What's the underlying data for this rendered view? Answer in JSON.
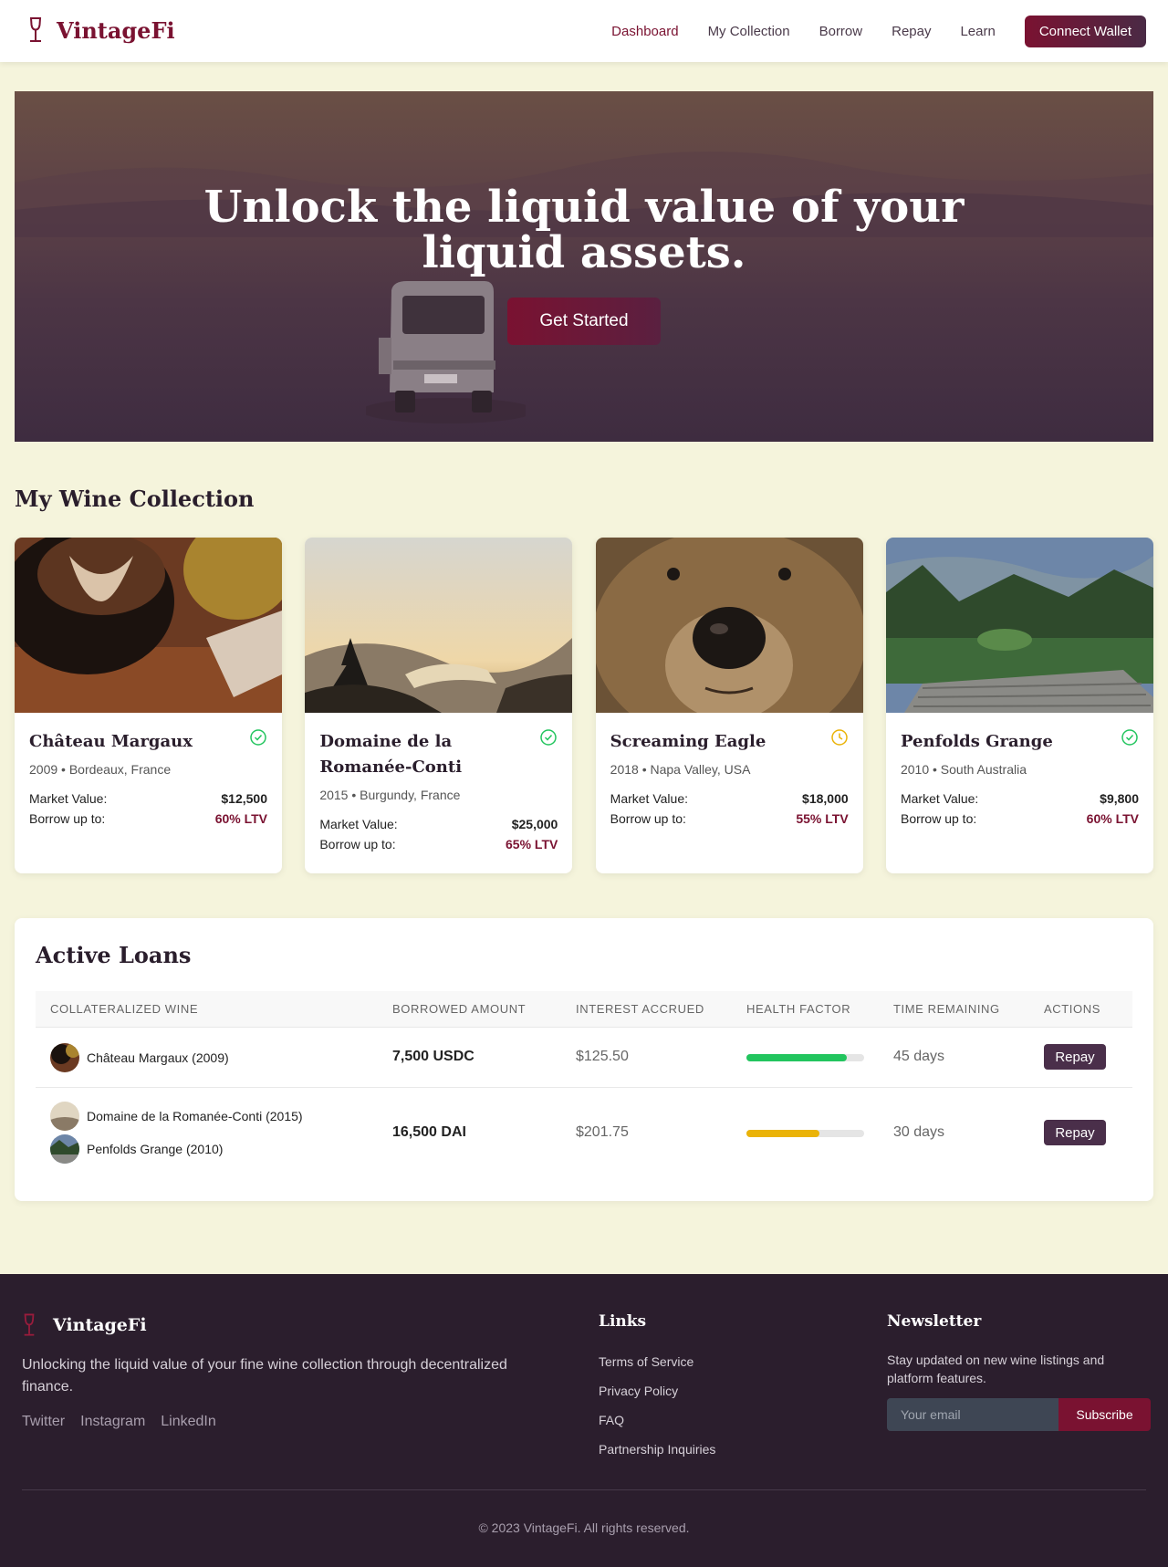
{
  "nav": {
    "brand": "VintageFi",
    "links": [
      "Dashboard",
      "My Collection",
      "Borrow",
      "Repay",
      "Learn"
    ],
    "active": "Dashboard",
    "cta": "Connect Wallet"
  },
  "hero": {
    "title_line1": "Unlock the liquid value of your",
    "title_line2": "liquid assets.",
    "cta": "Get Started"
  },
  "collection": {
    "title": "My Wine Collection",
    "market_label": "Market Value:",
    "borrow_label": "Borrow up to:",
    "cards": [
      {
        "name": "Château Margaux",
        "meta": "2009 • Bordeaux, France",
        "value": "$12,500",
        "ltv": "60% LTV",
        "status": "verified",
        "image": "coffee-cup"
      },
      {
        "name": "Domaine de la Romanée-Conti",
        "meta": "2015 • Burgundy, France",
        "value": "$25,000",
        "ltv": "65% LTV",
        "status": "verified",
        "image": "sunset-valley"
      },
      {
        "name": "Screaming Eagle",
        "meta": "2018 • Napa Valley, USA",
        "value": "$18,000",
        "ltv": "55% LTV",
        "status": "pending",
        "image": "bear-face"
      },
      {
        "name": "Penfolds Grange",
        "meta": "2010 • South Australia",
        "value": "$9,800",
        "ltv": "60% LTV",
        "status": "verified",
        "image": "lake-dock"
      }
    ]
  },
  "loans": {
    "title": "Active Loans",
    "headers": [
      "COLLATERALIZED WINE",
      "BORROWED AMOUNT",
      "INTEREST ACCRUED",
      "HEALTH FACTOR",
      "TIME REMAINING",
      "ACTIONS"
    ],
    "rows": [
      {
        "wines": [
          "Château Margaux (2009)"
        ],
        "amount": "7,500 USDC",
        "interest": "$125.50",
        "health": 0.85,
        "health_color": "#22c55e",
        "time": "45 days",
        "action": "Repay"
      },
      {
        "wines": [
          "Domaine de la Romanée-Conti (2015)",
          "Penfolds Grange (2010)"
        ],
        "amount": "16,500 DAI",
        "interest": "$201.75",
        "health": 0.62,
        "health_color": "#eab308",
        "time": "30 days",
        "action": "Repay"
      }
    ]
  },
  "footer": {
    "brand": "VintageFi",
    "description": "Unlocking the liquid value of your fine wine collection through decentralized finance.",
    "social": [
      "Twitter",
      "Instagram",
      "LinkedIn"
    ],
    "links_title": "Links",
    "links": [
      "Terms of Service",
      "Privacy Policy",
      "FAQ",
      "Partnership Inquiries"
    ],
    "newsletter_title": "Newsletter",
    "newsletter_text": "Stay updated on new wine listings and platform features.",
    "email_placeholder": "Your email",
    "subscribe": "Subscribe",
    "copyright": "© 2023 VintageFi. All rights reserved."
  },
  "colors": {
    "accent": "#7a1231",
    "plum": "#4a2f4a",
    "footer_bg": "#2b1e2d",
    "page_bg": "#f5f4dc"
  }
}
